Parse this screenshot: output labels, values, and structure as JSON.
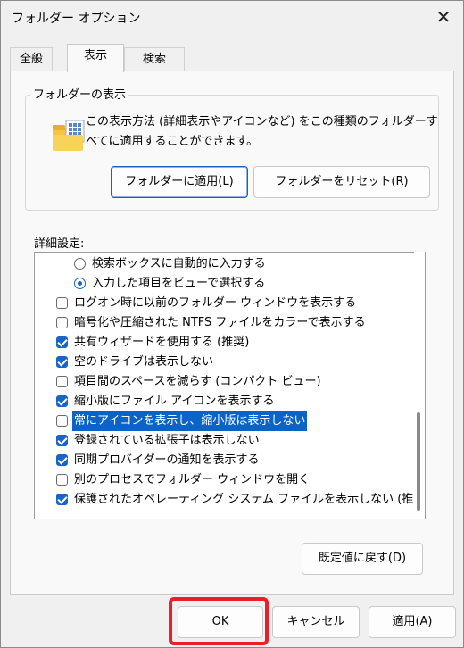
{
  "window": {
    "title": "フォルダー オプション",
    "close_glyph": "✕"
  },
  "tabs": [
    {
      "label": "全般"
    },
    {
      "label": "表示"
    },
    {
      "label": "検索"
    }
  ],
  "folder_views": {
    "group_label": "フォルダーの表示",
    "description": "この表示方法 (詳細表示やアイコンなど) をこの種類のフォルダーすべてに適用することができます。",
    "apply_button": "フォルダーに適用(L)",
    "reset_button": "フォルダーをリセット(R)"
  },
  "advanced": {
    "label": "詳細設定:",
    "items": [
      {
        "type": "radio",
        "checked": false,
        "label": "検索ボックスに自動的に入力する"
      },
      {
        "type": "radio",
        "checked": true,
        "label": "入力した項目をビューで選択する"
      },
      {
        "type": "checkbox",
        "checked": false,
        "label": "ログオン時に以前のフォルダー ウィンドウを表示する"
      },
      {
        "type": "checkbox",
        "checked": false,
        "label": "暗号化や圧縮された NTFS ファイルをカラーで表示する"
      },
      {
        "type": "checkbox",
        "checked": true,
        "label": "共有ウィザードを使用する (推奨)"
      },
      {
        "type": "checkbox",
        "checked": true,
        "label": "空のドライブは表示しない"
      },
      {
        "type": "checkbox",
        "checked": false,
        "label": "項目間のスペースを減らす (コンパクト ビュー)"
      },
      {
        "type": "checkbox",
        "checked": true,
        "label": "縮小版にファイル アイコンを表示する"
      },
      {
        "type": "checkbox",
        "checked": false,
        "label": "常にアイコンを表示し、縮小版は表示しない",
        "selected": true
      },
      {
        "type": "checkbox",
        "checked": true,
        "label": "登録されている拡張子は表示しない"
      },
      {
        "type": "checkbox",
        "checked": true,
        "label": "同期プロバイダーの通知を表示する"
      },
      {
        "type": "checkbox",
        "checked": false,
        "label": "別のプロセスでフォルダー ウィンドウを開く"
      },
      {
        "type": "checkbox",
        "checked": true,
        "label": "保護されたオペレーティング システム ファイルを表示しない (推奨)"
      }
    ],
    "restore_button": "既定値に戻す(D)"
  },
  "footer": {
    "ok": "OK",
    "cancel": "キャンセル",
    "apply": "適用(A)"
  },
  "colors": {
    "accent": "#1864c8",
    "selection": "#0a63c7",
    "highlight_box": "#e8202a"
  }
}
